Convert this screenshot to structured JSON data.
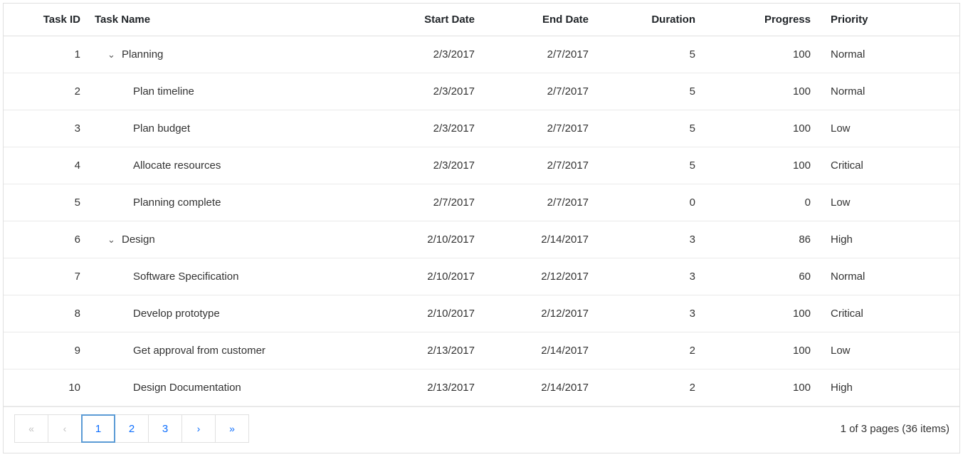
{
  "columns": {
    "task_id": "Task ID",
    "task_name": "Task Name",
    "start_date": "Start Date",
    "end_date": "End Date",
    "duration": "Duration",
    "progress": "Progress",
    "priority": "Priority"
  },
  "rows": [
    {
      "id": "1",
      "name": "Planning",
      "indent": 0,
      "expandable": true,
      "start": "2/3/2017",
      "end": "2/7/2017",
      "duration": "5",
      "progress": "100",
      "priority": "Normal"
    },
    {
      "id": "2",
      "name": "Plan timeline",
      "indent": 1,
      "expandable": false,
      "start": "2/3/2017",
      "end": "2/7/2017",
      "duration": "5",
      "progress": "100",
      "priority": "Normal"
    },
    {
      "id": "3",
      "name": "Plan budget",
      "indent": 1,
      "expandable": false,
      "start": "2/3/2017",
      "end": "2/7/2017",
      "duration": "5",
      "progress": "100",
      "priority": "Low"
    },
    {
      "id": "4",
      "name": "Allocate resources",
      "indent": 1,
      "expandable": false,
      "start": "2/3/2017",
      "end": "2/7/2017",
      "duration": "5",
      "progress": "100",
      "priority": "Critical"
    },
    {
      "id": "5",
      "name": "Planning complete",
      "indent": 1,
      "expandable": false,
      "start": "2/7/2017",
      "end": "2/7/2017",
      "duration": "0",
      "progress": "0",
      "priority": "Low"
    },
    {
      "id": "6",
      "name": "Design",
      "indent": 0,
      "expandable": true,
      "start": "2/10/2017",
      "end": "2/14/2017",
      "duration": "3",
      "progress": "86",
      "priority": "High"
    },
    {
      "id": "7",
      "name": "Software Specification",
      "indent": 1,
      "expandable": false,
      "start": "2/10/2017",
      "end": "2/12/2017",
      "duration": "3",
      "progress": "60",
      "priority": "Normal"
    },
    {
      "id": "8",
      "name": "Develop prototype",
      "indent": 1,
      "expandable": false,
      "start": "2/10/2017",
      "end": "2/12/2017",
      "duration": "3",
      "progress": "100",
      "priority": "Critical"
    },
    {
      "id": "9",
      "name": "Get approval from customer",
      "indent": 1,
      "expandable": false,
      "start": "2/13/2017",
      "end": "2/14/2017",
      "duration": "2",
      "progress": "100",
      "priority": "Low"
    },
    {
      "id": "10",
      "name": "Design Documentation",
      "indent": 1,
      "expandable": false,
      "start": "2/13/2017",
      "end": "2/14/2017",
      "duration": "2",
      "progress": "100",
      "priority": "High"
    }
  ],
  "pager": {
    "pages": [
      "1",
      "2",
      "3"
    ],
    "current_index": 0,
    "summary": "1 of 3 pages (36 items)"
  }
}
